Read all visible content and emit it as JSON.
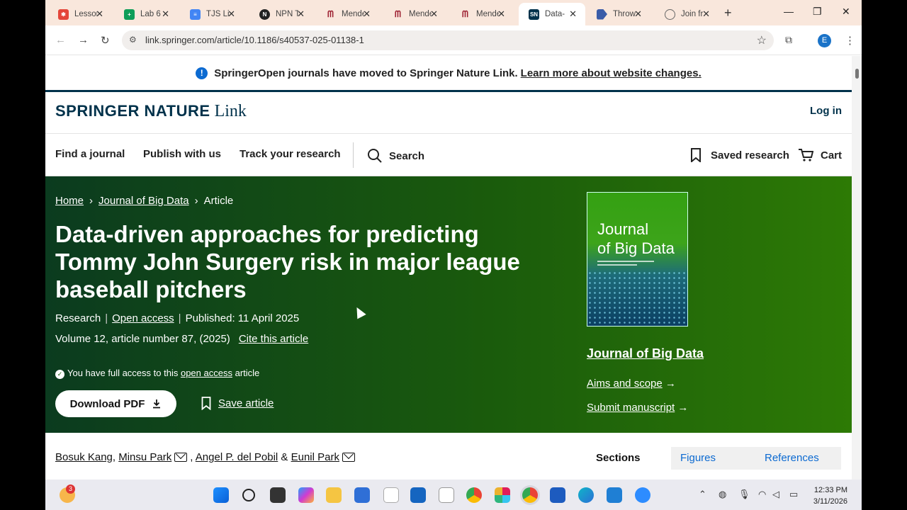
{
  "browser": {
    "tabs": [
      {
        "title": "Lessor",
        "color": "#e4463a"
      },
      {
        "title": "Lab 6",
        "color": "#0f9d58"
      },
      {
        "title": "TJS Lis",
        "color": "#4285f4"
      },
      {
        "title": "NPN T",
        "color": "#222222"
      },
      {
        "title": "Mende",
        "color": "#9b1c2e"
      },
      {
        "title": "Mende",
        "color": "#9b1c2e"
      },
      {
        "title": "Mende",
        "color": "#9b1c2e"
      },
      {
        "title": "Data-",
        "color": "#01324b",
        "active": true
      },
      {
        "title": "Throw",
        "color": "#3a5ca8"
      },
      {
        "title": "Join fr",
        "color": "#666666"
      }
    ],
    "url": "link.springer.com/article/10.1186/s40537-025-01138-1",
    "avatar_letter": "E"
  },
  "notice": {
    "text": "SpringerOpen journals have moved to Springer Nature Link.",
    "link": "Learn more about website changes."
  },
  "header": {
    "logo_main": "SPRINGER NATURE",
    "logo_link": "Link",
    "login": "Log in"
  },
  "nav": {
    "find_journal": "Find a journal",
    "publish": "Publish with us",
    "track": "Track your research",
    "search": "Search",
    "saved": "Saved research",
    "cart": "Cart"
  },
  "article": {
    "breadcrumb": {
      "home": "Home",
      "journal": "Journal of Big Data",
      "current": "Article"
    },
    "title": "Data-driven approaches for predicting Tommy John Surgery risk in major league baseball pitchers",
    "type": "Research",
    "access": "Open access",
    "published": "Published: 11 April 2025",
    "volume": "Volume 12, article number 87, (2025)",
    "cite": "Cite this article",
    "access_prefix": "You have full access to this",
    "access_link": "open access",
    "access_suffix": "article",
    "download": "Download PDF",
    "save": "Save article",
    "authors": [
      "Bosuk Kang",
      "Minsu Park",
      "Angel P. del Pobil",
      "Eunil Park"
    ]
  },
  "journal_box": {
    "cover_line1": "Journal",
    "cover_line2": "of Big Data",
    "title": "Journal of Big Data",
    "aims": "Aims and scope",
    "submit": "Submit manuscript"
  },
  "section_tabs": [
    "Sections",
    "Figures",
    "References"
  ],
  "taskbar": {
    "time": "12:33 PM",
    "date": "3/11/2026",
    "badge": "3"
  }
}
